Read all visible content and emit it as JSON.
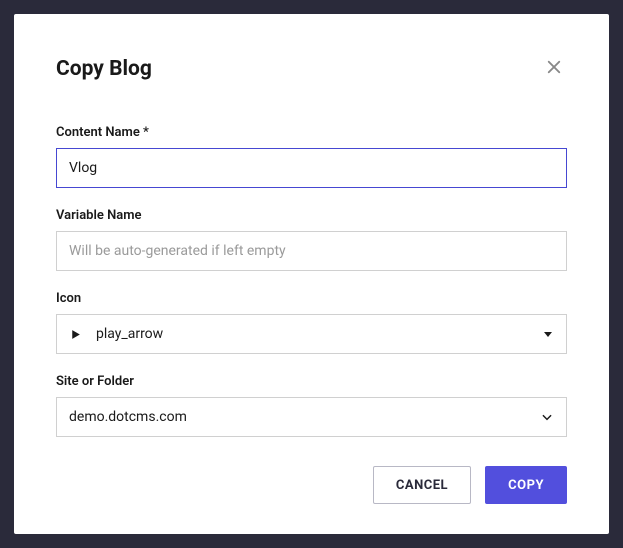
{
  "dialog": {
    "title": "Copy Blog"
  },
  "fields": {
    "contentName": {
      "label": "Content Name *",
      "value": "Vlog"
    },
    "variableName": {
      "label": "Variable Name",
      "value": "",
      "placeholder": "Will be auto-generated if left empty"
    },
    "icon": {
      "label": "Icon",
      "value": "play_arrow"
    },
    "siteOrFolder": {
      "label": "Site or Folder",
      "value": "demo.dotcms.com"
    }
  },
  "buttons": {
    "cancel": "CANCEL",
    "copy": "COPY"
  }
}
